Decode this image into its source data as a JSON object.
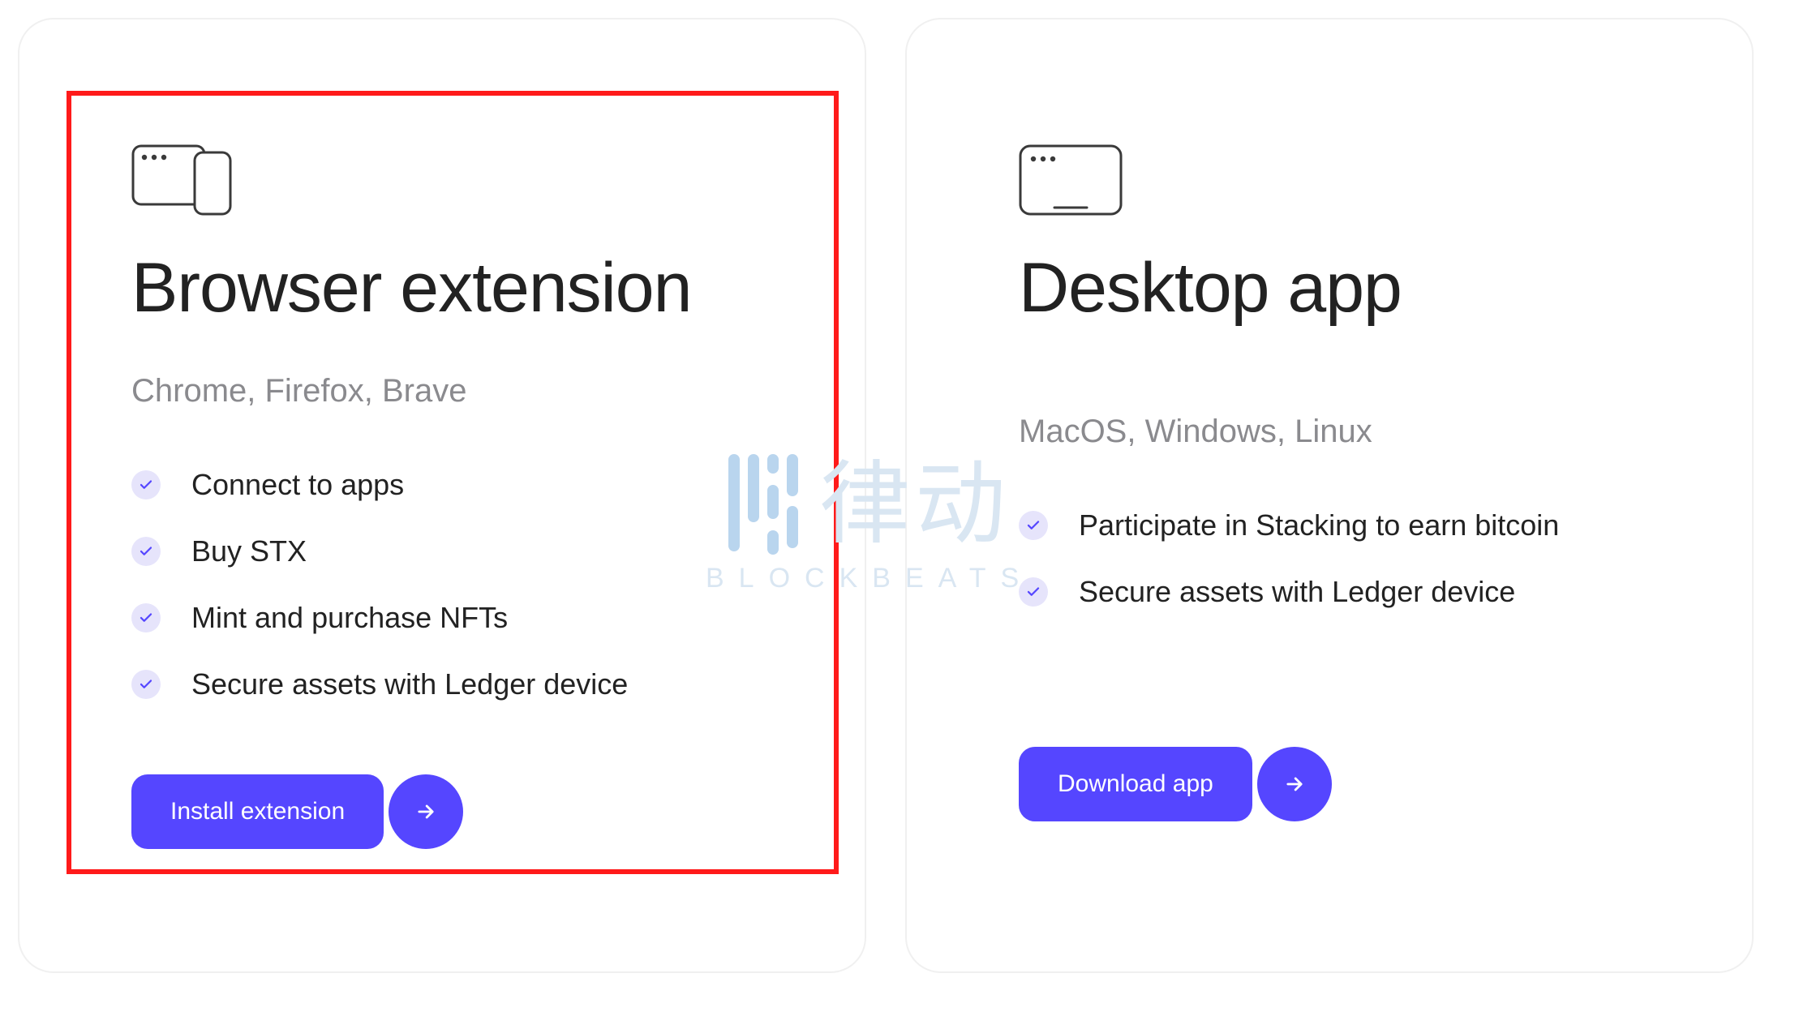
{
  "watermark": {
    "cjk": "律动",
    "sub": "BLOCKBEATS"
  },
  "cards": {
    "left": {
      "title": "Browser extension",
      "subtitle": "Chrome, Firefox, Brave",
      "features": [
        "Connect to apps",
        "Buy STX",
        "Mint and purchase NFTs",
        "Secure assets with Ledger device"
      ],
      "cta": "Install extension"
    },
    "right": {
      "title": "Desktop app",
      "subtitle": "MacOS, Windows, Linux",
      "features": [
        "Participate in Stacking to earn bitcoin",
        "Secure assets with Ledger device"
      ],
      "cta": "Download app"
    }
  }
}
